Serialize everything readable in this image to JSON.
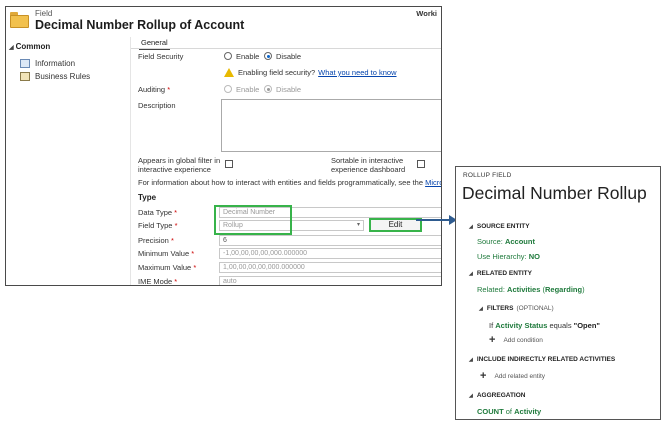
{
  "left_window": {
    "entity_label": "Field",
    "title": "Decimal Number Rollup of Account",
    "top_right_text": "Worki",
    "nav": {
      "section": "Common",
      "items": [
        {
          "label": "Information",
          "icon": "information-icon"
        },
        {
          "label": "Business Rules",
          "icon": "business-rules-icon"
        }
      ]
    },
    "form": {
      "tab": "General",
      "field_security": {
        "label": "Field Security",
        "options": [
          "Enable",
          "Disable"
        ],
        "selected": "Disable"
      },
      "warning": {
        "text": "Enabling field security?",
        "link": "What you need to know"
      },
      "auditing": {
        "label": "Auditing",
        "options": [
          "Enable",
          "Disable"
        ],
        "selected": "Disable"
      },
      "description_label": "Description",
      "global_filter_label_1": "Appears in global filter in",
      "global_filter_label_2": "interactive experience",
      "sortable_label_1": "Sortable in interactive",
      "sortable_label_2": "experience dashboard",
      "info_text": "For information about how to interact with entities and fields programmatically, see the",
      "info_link": "Microsoft Dyn",
      "type_section": "Type",
      "data_type": {
        "label": "Data Type",
        "value": "Decimal Number"
      },
      "field_type": {
        "label": "Field Type",
        "value": "Rollup"
      },
      "edit_button": "Edit",
      "precision": {
        "label": "Precision",
        "value": "6"
      },
      "minimum_value": {
        "label": "Minimum Value",
        "value": "-1,00,00,00,00,000.000000"
      },
      "maximum_value": {
        "label": "Maximum Value",
        "value": "1,00,00,00,00,000.000000"
      },
      "ime_mode": {
        "label": "IME Mode",
        "value": "auto"
      }
    }
  },
  "rollup_panel": {
    "eyebrow": "ROLLUP FIELD",
    "title": "Decimal Number Rollup",
    "source_entity": {
      "heading": "SOURCE ENTITY",
      "source_label": "Source:",
      "source_value": "Account",
      "hierarchy_label": "Use Hierarchy:",
      "hierarchy_value": "NO"
    },
    "related_entity": {
      "heading": "RELATED ENTITY",
      "related_label": "Related:",
      "related_value": "Activities",
      "related_qualifier": "Regarding"
    },
    "filters": {
      "heading": "FILTERS",
      "optional": "(OPTIONAL)",
      "if_word": "If",
      "field": "Activity Status",
      "operator": "equals",
      "value": "\"Open\"",
      "add_label": "Add condition"
    },
    "indirect": {
      "heading": "INCLUDE INDIRECTLY RELATED ACTIVITIES",
      "add_label": "Add related entity"
    },
    "aggregation": {
      "heading": "AGGREGATION",
      "function": "COUNT",
      "of_word": "of",
      "field": "Activity"
    }
  },
  "colors": {
    "highlight_green": "#37b34a",
    "arrow_blue": "#2e5b8f",
    "rollup_green": "#1f7a3c",
    "link_blue": "#0645ad"
  }
}
